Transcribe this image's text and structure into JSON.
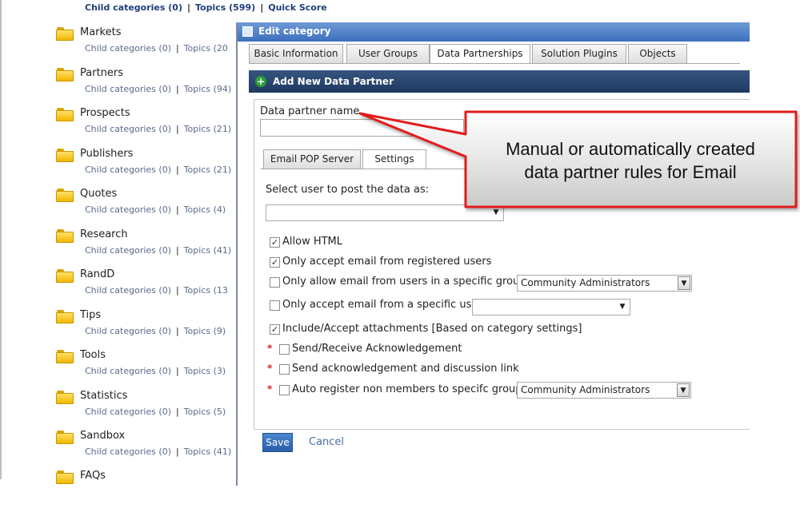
{
  "background": {
    "top_links": {
      "child_categories": "Child categories (0)",
      "topics": "Topics (599)",
      "quick_score": "Quick Score"
    },
    "categories": [
      {
        "name": "Markets",
        "child": "Child categories (0)",
        "topics": "Topics (20"
      },
      {
        "name": "Partners",
        "child": "Child categories (0)",
        "topics": "Topics (94)"
      },
      {
        "name": "Prospects",
        "child": "Child categories (0)",
        "topics": "Topics (21)"
      },
      {
        "name": "Publishers",
        "child": "Child categories (0)",
        "topics": "Topics (21)"
      },
      {
        "name": "Quotes",
        "child": "Child categories (0)",
        "topics": "Topics (4)"
      },
      {
        "name": "Research",
        "child": "Child categories (0)",
        "topics": "Topics (41)"
      },
      {
        "name": "RandD",
        "child": "Child categories (0)",
        "topics": "Topics (13"
      },
      {
        "name": "Tips",
        "child": "Child categories (0)",
        "topics": "Topics (9)"
      },
      {
        "name": "Tools",
        "child": "Child categories (0)",
        "topics": "Topics (3)"
      },
      {
        "name": "Statistics",
        "child": "Child categories (0)",
        "topics": "Topics (5)"
      },
      {
        "name": "Sandbox",
        "child": "Child categories (0)",
        "topics": "Topics (41)"
      },
      {
        "name": "FAQs",
        "child": "",
        "topics": ""
      }
    ]
  },
  "dialog": {
    "title": "Edit category",
    "tabs": [
      "Basic Information",
      "User Groups",
      "Data Partnerships",
      "Solution Plugins",
      "Objects"
    ],
    "active_tab": "Data Partnerships",
    "section_title": "Add New Data Partner",
    "data_partner_name_label": "Data partner name",
    "data_partner_name_value": "",
    "subtabs": [
      "Email POP Server",
      "Settings"
    ],
    "active_subtab": "Settings",
    "select_user_label": "Select user to post the data as:",
    "select_user_value": "",
    "options": {
      "allow_html": {
        "label": "Allow HTML",
        "checked": true
      },
      "only_registered": {
        "label": "Only accept email from registered users",
        "checked": true
      },
      "specific_group": {
        "label": "Only allow email from users in a specific group",
        "checked": false,
        "select_value": "Community Administrators"
      },
      "specific_user": {
        "label": "Only accept email from a specific user",
        "checked": false,
        "select_value": ""
      },
      "attachments": {
        "label": "Include/Accept attachments [Based on category settings]",
        "checked": true
      },
      "send_ack": {
        "label": "Send/Receive Acknowledgement",
        "checked": false,
        "required_mark": "*"
      },
      "send_ack_link": {
        "label": "Send acknowledgement and discussion link",
        "checked": false,
        "required_mark": "*"
      },
      "auto_register": {
        "label": "Auto register non members to specifc group",
        "checked": false,
        "required_mark": "*",
        "select_value": "Community Administrators"
      }
    },
    "save_label": "Save",
    "cancel_label": "Cancel"
  },
  "callout": {
    "line1": "Manual or automatically created",
    "line2": "data partner rules for Email"
  },
  "colors": {
    "callout_border": "#e21b1b",
    "section_bar": "#27446e",
    "titlebar": "#4f7fc6",
    "link_blue": "#1f3d7a"
  }
}
